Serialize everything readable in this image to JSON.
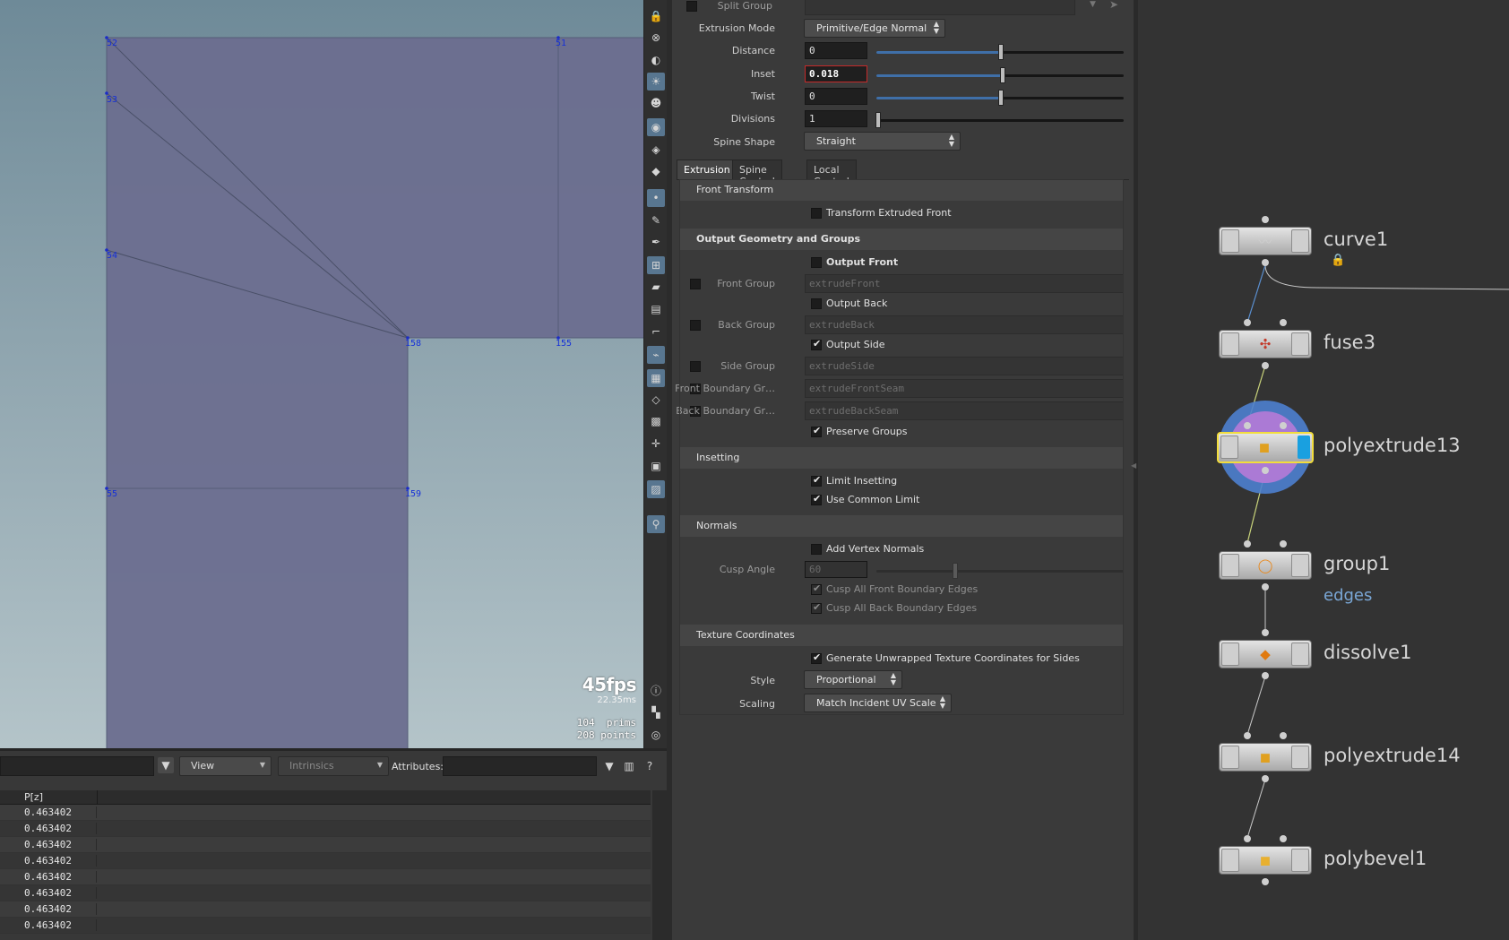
{
  "viewport": {
    "point_labels": [
      "52",
      "51",
      "53",
      "54",
      "158",
      "155",
      "55",
      "159"
    ],
    "fps": "45fps",
    "frame_ms": "22.35ms",
    "prims_count": "104",
    "prims_label": "prims",
    "points_count": "208",
    "points_label": "points"
  },
  "toolbar_icons": [
    "lock-icon",
    "close-circle-icon",
    "globe-icon",
    "light-icon",
    "skull-icon",
    "camera-icon",
    "eye-snap-icon",
    "select-visible-icon",
    "point-mode-icon",
    "brush-icon",
    "pen-icon",
    "snap-grid-icon",
    "paint-icon",
    "stack-icon",
    "corner-icon",
    "tweak-icon",
    "checker-icon",
    "layers-icon",
    "uv-icon",
    "handle-icon",
    "record-icon",
    "capture-icon",
    "pin-icon",
    "info-icon",
    "layout-icon",
    "eye-icon"
  ],
  "spreadsheet": {
    "view_label": "View",
    "intrinsics_label": "Intrinsics",
    "attributes_label": "Attributes:",
    "column_header": "P[z]",
    "rows": [
      "0.463402",
      "0.463402",
      "0.463402",
      "0.463402",
      "0.463402",
      "0.463402",
      "0.463402",
      "0.463402"
    ]
  },
  "params": {
    "split_group_label": "Split Group",
    "extrusion_mode_label": "Extrusion Mode",
    "extrusion_mode_value": "Primitive/Edge Normal",
    "distance_label": "Distance",
    "distance_value": "0",
    "inset_label": "Inset",
    "inset_value": "0.018",
    "twist_label": "Twist",
    "twist_value": "0",
    "divisions_label": "Divisions",
    "divisions_value": "1",
    "spine_shape_label": "Spine Shape",
    "spine_shape_value": "Straight",
    "tabs": [
      "Extrusion",
      "Spine Control",
      "Local Control"
    ],
    "front_transform_section": "Front Transform",
    "transform_extruded_front": "Transform Extruded Front",
    "output_section": "Output Geometry and Groups",
    "output_front": "Output Front",
    "front_group_label": "Front Group",
    "front_group_value": "extrudeFront",
    "output_back": "Output Back",
    "back_group_label": "Back Group",
    "back_group_value": "extrudeBack",
    "output_side": "Output Side",
    "side_group_label": "Side Group",
    "side_group_value": "extrudeSide",
    "front_boundary_label": "Front Boundary Gr…",
    "front_boundary_value": "extrudeFrontSeam",
    "back_boundary_label": "Back Boundary Gr…",
    "back_boundary_value": "extrudeBackSeam",
    "preserve_groups": "Preserve Groups",
    "insetting_section": "Insetting",
    "limit_insetting": "Limit Insetting",
    "use_common_limit": "Use Common Limit",
    "normals_section": "Normals",
    "add_vertex_normals": "Add Vertex Normals",
    "cusp_angle_label": "Cusp Angle",
    "cusp_angle_value": "60",
    "cusp_front": "Cusp All Front Boundary Edges",
    "cusp_back": "Cusp All Back Boundary Edges",
    "texture_section": "Texture Coordinates",
    "generate_uv": "Generate Unwrapped Texture Coordinates for Sides",
    "style_label": "Style",
    "style_value": "Proportional",
    "scaling_label": "Scaling",
    "scaling_value": "Match Incident UV Scale"
  },
  "network": {
    "nodes": [
      "curve1",
      "fuse3",
      "polyextrude13",
      "group1",
      "dissolve1",
      "polyextrude14",
      "polybevel1"
    ],
    "group1_sub": "edges"
  }
}
